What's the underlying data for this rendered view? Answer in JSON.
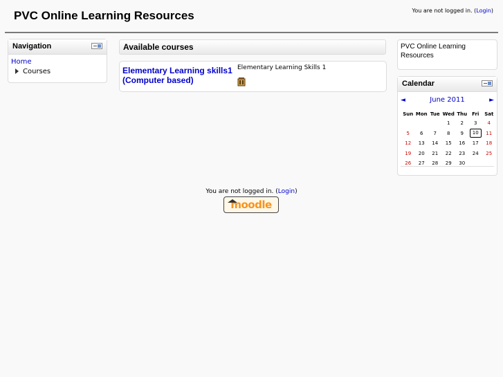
{
  "header": {
    "site_title": "PVC Online Learning Resources",
    "login_prefix": "You are not logged in. (",
    "login_link": "Login",
    "login_suffix": ")"
  },
  "navigation": {
    "title": "Navigation",
    "home": "Home",
    "courses": "Courses"
  },
  "available_courses": {
    "title": "Available courses",
    "courses": [
      {
        "name": "Elementary Learning skills1 (Computer based)",
        "summary": "Elementary Learning Skills 1"
      }
    ]
  },
  "site_block": {
    "text": "PVC Online Learning Resources"
  },
  "calendar": {
    "title": "Calendar",
    "prev": "◄",
    "next": "►",
    "month": "June 2011",
    "weekdays": [
      "Sun",
      "Mon",
      "Tue",
      "Wed",
      "Thu",
      "Fri",
      "Sat"
    ],
    "weeks": [
      [
        "",
        "",
        "",
        "1",
        "2",
        "3",
        "4"
      ],
      [
        "5",
        "6",
        "7",
        "8",
        "9",
        "10",
        "11"
      ],
      [
        "12",
        "13",
        "14",
        "15",
        "16",
        "17",
        "18"
      ],
      [
        "19",
        "20",
        "21",
        "22",
        "23",
        "24",
        "25"
      ],
      [
        "26",
        "27",
        "28",
        "29",
        "30",
        "",
        ""
      ]
    ],
    "today": "10",
    "weekend_color": "#cc0000"
  },
  "footer": {
    "login_prefix": "You are not logged in. (",
    "login_link": "Login",
    "login_suffix": ")",
    "logo_text": "moodle"
  }
}
